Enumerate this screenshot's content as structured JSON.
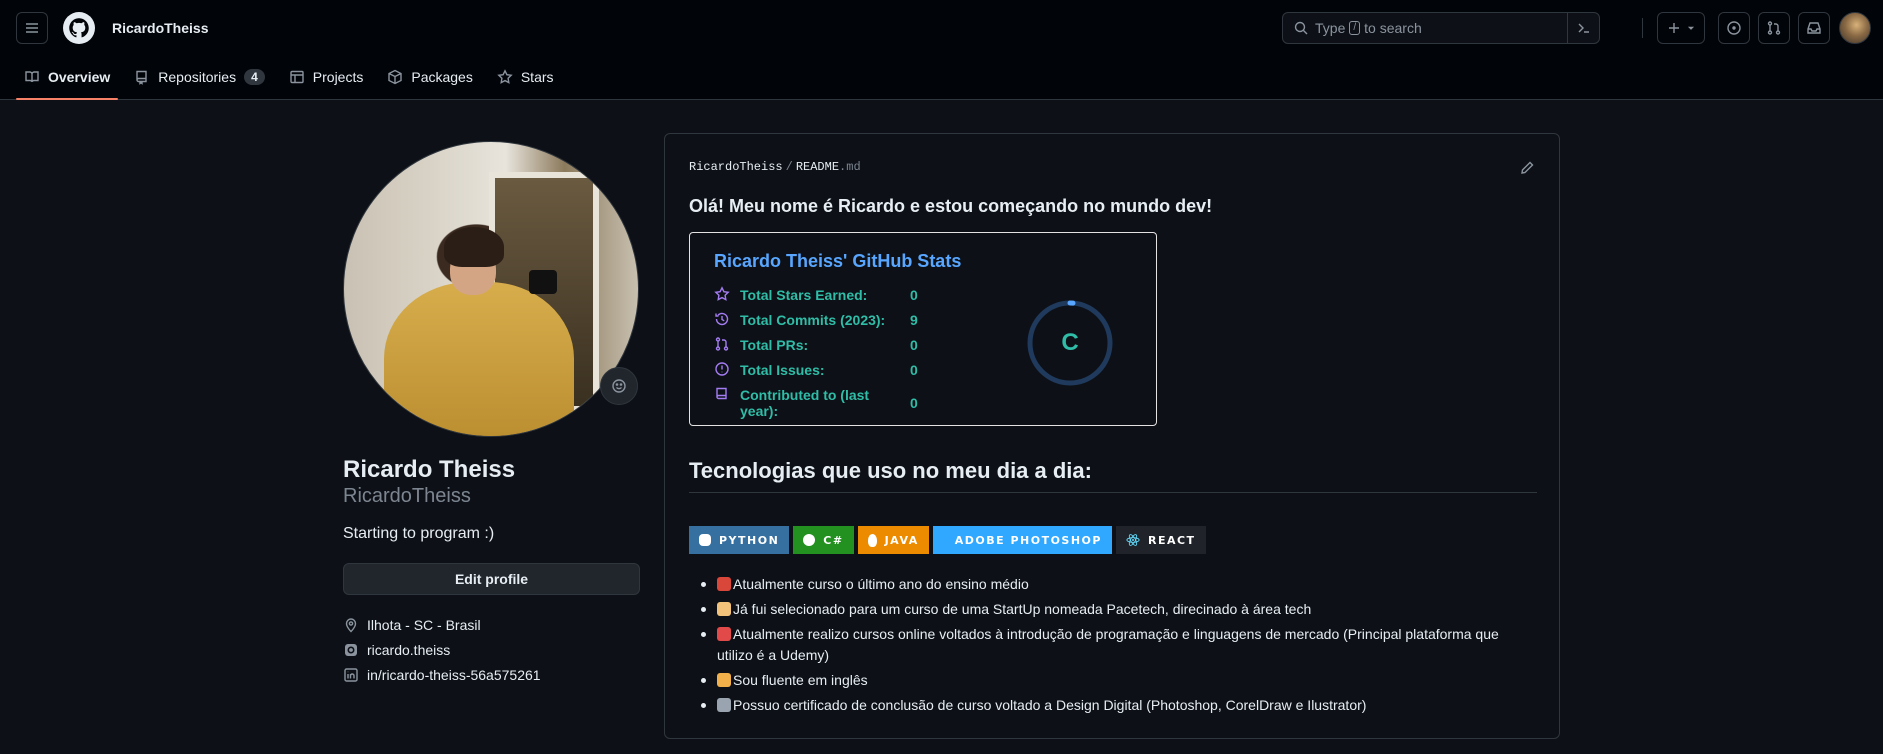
{
  "header": {
    "username": "RicardoTheiss",
    "search": {
      "prefix": "Type",
      "key": "/",
      "suffix": "to search"
    }
  },
  "tabs": [
    {
      "label": "Overview",
      "active": true
    },
    {
      "label": "Repositories",
      "count": "4"
    },
    {
      "label": "Projects"
    },
    {
      "label": "Packages"
    },
    {
      "label": "Stars"
    }
  ],
  "profile": {
    "full_name": "Ricardo Theiss",
    "login": "RicardoTheiss",
    "bio": "Starting to program :)",
    "edit_label": "Edit profile",
    "location": "Ilhota - SC - Brasil",
    "instagram": "ricardo.theiss",
    "linkedin": "in/ricardo-theiss-56a575261"
  },
  "readme": {
    "path_user": "RicardoTheiss",
    "path_sep": "/",
    "path_file": "README",
    "path_ext": ".md",
    "greeting": "Olá! Meu nome é Ricardo e estou começando no mundo dev!",
    "stats": {
      "title": "Ricardo Theiss' GitHub Stats",
      "rows": [
        {
          "label": "Total Stars Earned:",
          "value": "0",
          "icon": "star-icon"
        },
        {
          "label": "Total Commits (2023):",
          "value": "9",
          "icon": "history-icon"
        },
        {
          "label": "Total PRs:",
          "value": "0",
          "icon": "pull-request-icon"
        },
        {
          "label": "Total Issues:",
          "value": "0",
          "icon": "issue-icon"
        },
        {
          "label": "Contributed to (last year):",
          "value": "0",
          "icon": "repo-icon"
        }
      ],
      "grade": "C",
      "accent": "#2fbda7",
      "title_color": "#58a6ff",
      "icon_color": "#a47cf2"
    },
    "tech_heading": "Tecnologias que uso no meu dia a dia:",
    "badges": [
      {
        "label": "PYTHON",
        "color": "#3670a0",
        "icon": "python-icon"
      },
      {
        "label": "C#",
        "color": "#239120",
        "icon": "csharp-icon"
      },
      {
        "label": "JAVA",
        "color": "#ed8b00",
        "icon": "java-icon"
      },
      {
        "label": "ADOBE PHOTOSHOP",
        "color": "#31a8ff",
        "icon": "photoshop-icon"
      },
      {
        "label": "REACT",
        "color": "#20232a",
        "icon": "react-icon"
      }
    ],
    "bullets": [
      {
        "text": "Atualmente curso o último ano do ensino médio",
        "icon": "backpack-icon",
        "color": "#d9463a"
      },
      {
        "text": "Já fui selecionado para um curso de uma StartUp nomeada Pacetech, direcinado à área tech",
        "icon": "technologist-icon",
        "color": "#f2c27a"
      },
      {
        "text": "Atualmente realizo cursos online voltados à introdução de programação e linguagens de mercado (Principal plataforma que utilizo é a Udemy)",
        "icon": "calendar-icon",
        "color": "#e24a4a"
      },
      {
        "text": "Sou fluente em inglês",
        "icon": "writing-hand-icon",
        "color": "#f2b04a"
      },
      {
        "text": "Possuo certificado de conclusão de curso voltado a Design Digital (Photoshop, CorelDraw e Ilustrator)",
        "icon": "laptop-icon",
        "color": "#9aa4b0"
      }
    ]
  }
}
